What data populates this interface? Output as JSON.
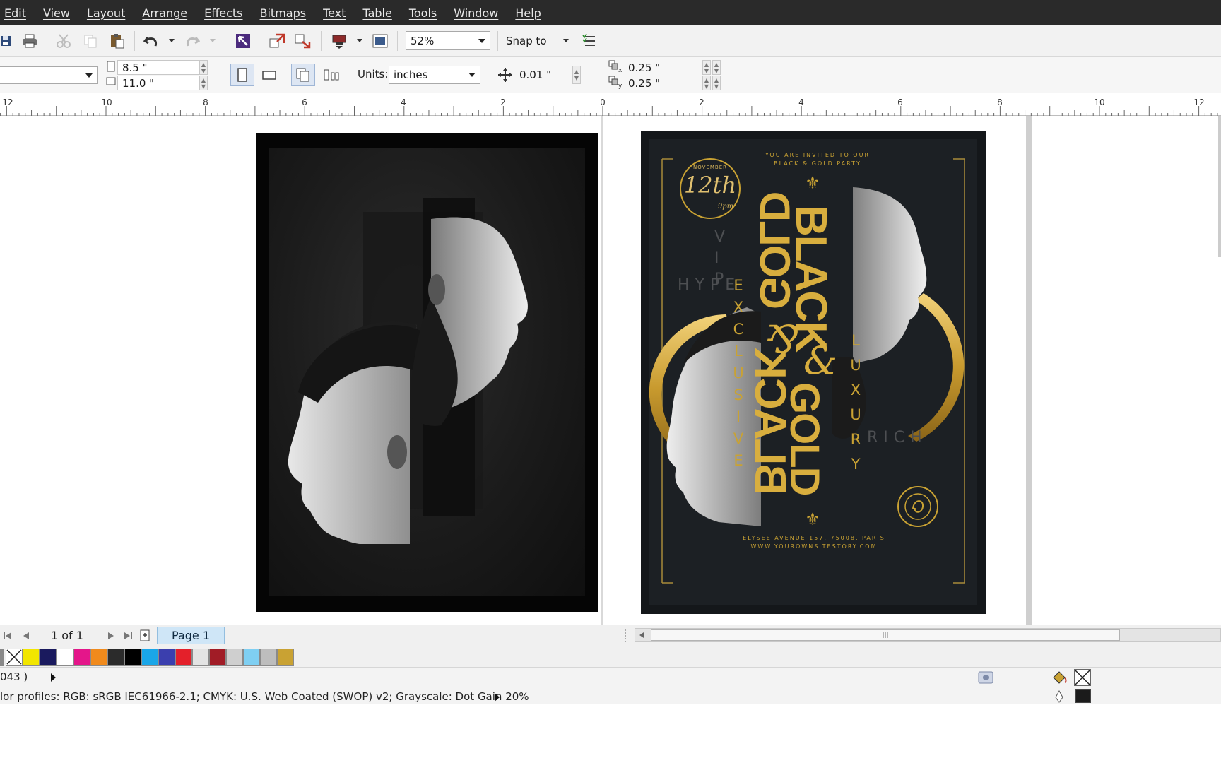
{
  "menu": {
    "items": [
      "Edit",
      "View",
      "Layout",
      "Arrange",
      "Effects",
      "Bitmaps",
      "Text",
      "Table",
      "Tools",
      "Window",
      "Help"
    ]
  },
  "toolbar": {
    "zoom_value": "52%",
    "snap_label": "Snap to"
  },
  "property_bar": {
    "page_width": "8.5 \"",
    "page_height": "11.0 \"",
    "units_label": "Units:",
    "units_value": "inches",
    "nudge_value": "0.01 \"",
    "dup_x": "0.25 \"",
    "dup_y": "0.25 \""
  },
  "ruler": {
    "labels": [
      "12",
      "10",
      "8",
      "6",
      "4",
      "2",
      "0",
      "2",
      "4",
      "6",
      "8",
      "10",
      "12"
    ]
  },
  "poster": {
    "top_line1": "YOU ARE INVITED TO OUR",
    "top_line2": "BLACK & GOLD PARTY",
    "date_month": "NOVEMBER",
    "date_day": "12th",
    "date_time": "9pm",
    "title_black": "BLACK",
    "title_gold": "GOLD",
    "ampersand": "&",
    "left_word": "EXCLUSIVE",
    "left_word2": "VIP",
    "hype": "HYPE",
    "right_word": "LUXURY",
    "rich": "RICH",
    "bottom_line1": "ELYSEE AVENUE 157, 75008, PARIS",
    "bottom_line2": "WWW.YOUROWNSITESTORY.COM",
    "fleur": "⚜"
  },
  "doc_nav": {
    "page_count": "1 of 1",
    "page_tab": "Page 1"
  },
  "palette": {
    "colors": [
      "#f2e600",
      "#1a1a5e",
      "#ffffff",
      "#e4168a",
      "#f08a1c",
      "#2b2b2b",
      "#000000",
      "#1aa6e8",
      "#3b3fae",
      "#e4202a",
      "#e3e3e3",
      "#a11c26",
      "#cfcfcf",
      "#7fcff2",
      "#bdbdbd",
      "#c9a233"
    ]
  },
  "status": {
    "coords": "043 )",
    "profiles": "lor profiles: RGB: sRGB IEC61966-2.1; CMYK: U.S. Web Coated (SWOP) v2; Grayscale: Dot Gain 20%"
  }
}
